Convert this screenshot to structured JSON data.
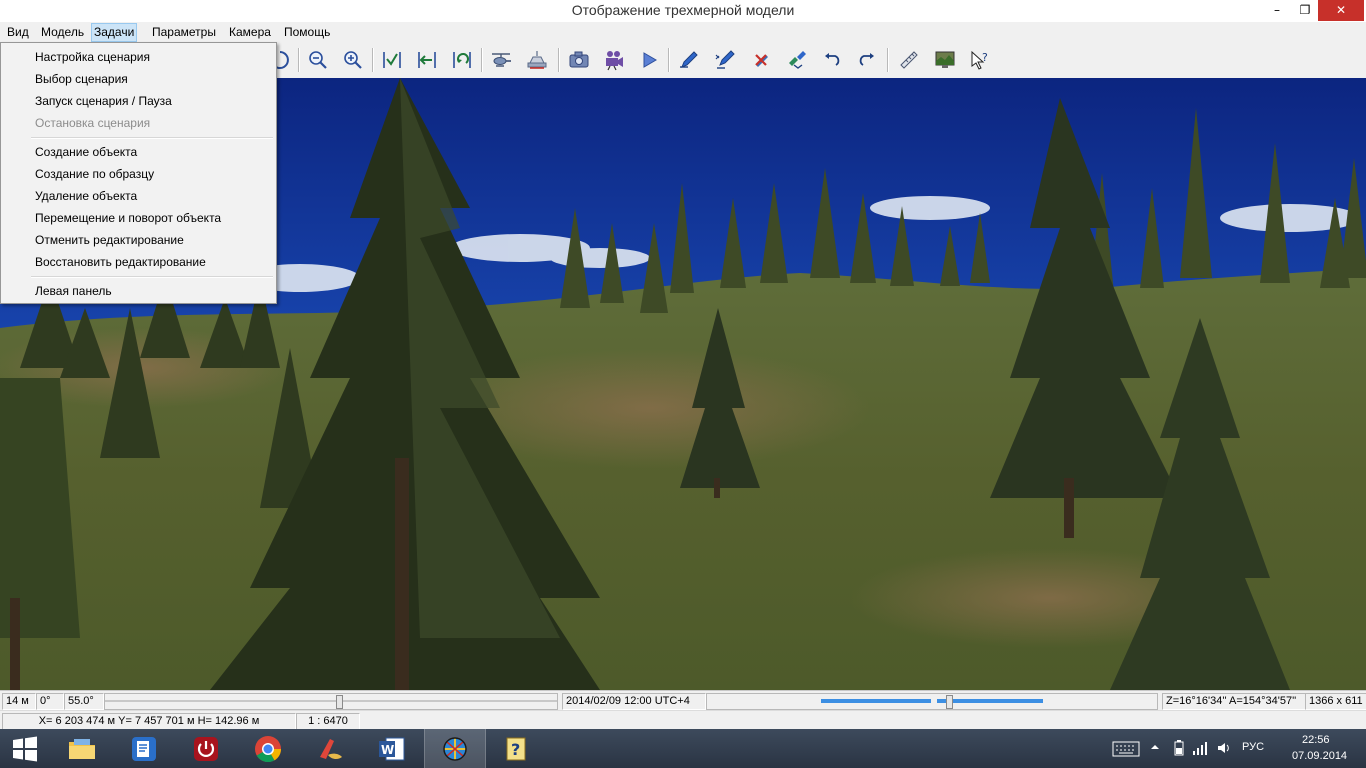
{
  "window": {
    "title": "Отображение трехмерной модели",
    "minimize": "–",
    "maximize": "❐",
    "close": "✕"
  },
  "menubar": [
    {
      "label": "Вид"
    },
    {
      "label": "Модель"
    },
    {
      "label": "Задачи",
      "open": true
    },
    {
      "label": "Параметры"
    },
    {
      "label": "Камера"
    },
    {
      "label": "Помощь"
    }
  ],
  "dropdown": {
    "items": [
      {
        "label": "Настройка сценария"
      },
      {
        "label": "Выбор сценария"
      },
      {
        "label": "Запуск сценария / Пауза"
      },
      {
        "label": "Остановка сценария",
        "disabled": true
      },
      {
        "label": "Создание объекта"
      },
      {
        "label": "Создание по образцу"
      },
      {
        "label": "Удаление объекта"
      },
      {
        "label": "Перемещение и поворот объекта"
      },
      {
        "label": "Отменить редактирование"
      },
      {
        "label": "Восстановить редактирование"
      },
      {
        "label": "Левая панель"
      }
    ]
  },
  "toolbar": {
    "icons": [
      "rotate-icon",
      "zoom-out-icon",
      "zoom-in-icon",
      "fit-view-icon",
      "move-left-icon",
      "reset-view-icon",
      "helicopter-icon",
      "vehicle-icon",
      "camera-icon",
      "video-camera-icon",
      "play-icon",
      "pen-icon",
      "pen-edit-icon",
      "delete-object-icon",
      "move-object-icon",
      "undo-icon",
      "redo-icon",
      "ruler-icon",
      "screen-icon",
      "help-pointer-icon"
    ]
  },
  "status": {
    "scale_m": "14 м",
    "angle1": "0°",
    "angle2": "55.0°",
    "datetime": "2014/02/09  12:00  UTC+4",
    "orientation": "Z=16°16'34''  A=154°34'57''",
    "resolution": "1366 x 611",
    "coordinates": "X= 6 203 474 м  Y= 7 457 701 м  H= 142.96 м",
    "map_scale": "1 : 6470",
    "time_slider_value": 0.54,
    "scale_slider_value": 0.52
  },
  "taskbar": {
    "apps": [
      "file-explorer-icon",
      "document-viewer-icon",
      "power-app-icon",
      "chrome-icon",
      "ccleaner-icon",
      "word-icon",
      "3d-globe-app-icon",
      "help-app-icon"
    ],
    "active_app": 6,
    "tray": {
      "language": "РУС",
      "time": "22:56",
      "date": "07.09.2014"
    }
  },
  "colors": {
    "accent": "#3c8fe3",
    "close_button": "#c7302a",
    "menu_highlight": "#cce4f7"
  }
}
